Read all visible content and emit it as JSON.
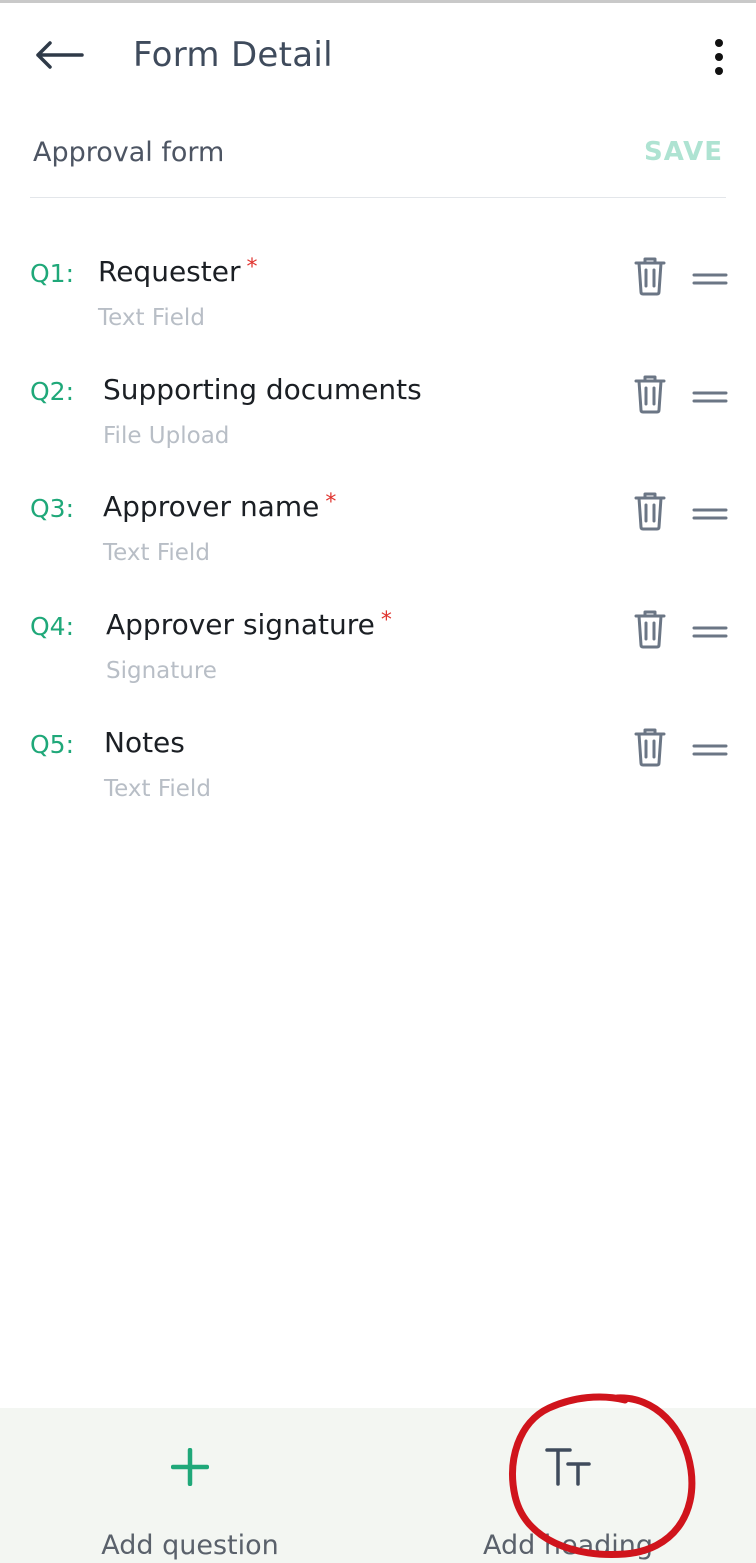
{
  "app_bar": {
    "title": "Form Detail",
    "back_icon": "arrow-left-icon",
    "more_icon": "more-vertical-icon"
  },
  "form": {
    "name": "Approval form",
    "save_label": "SAVE"
  },
  "questions": [
    {
      "number": "Q1:",
      "title": "Requester",
      "required": true,
      "type": "Text Field"
    },
    {
      "number": "Q2:",
      "title": "Supporting documents",
      "required": false,
      "type": "File Upload"
    },
    {
      "number": "Q3:",
      "title": "Approver name",
      "required": true,
      "type": "Text Field"
    },
    {
      "number": "Q4:",
      "title": "Approver signature",
      "required": true,
      "type": "Signature"
    },
    {
      "number": "Q5:",
      "title": "Notes",
      "required": false,
      "type": "Text Field"
    }
  ],
  "required_marker": "*",
  "bottom_bar": {
    "add_question_label": "Add question",
    "add_heading_label": "Add heading",
    "add_question_icon": "plus-icon",
    "add_heading_icon": "text-size-icon"
  },
  "colors": {
    "accent": "#1fa879",
    "save_disabled": "#aee3d2",
    "required": "#e0342f",
    "annotation": "#d0141c"
  }
}
